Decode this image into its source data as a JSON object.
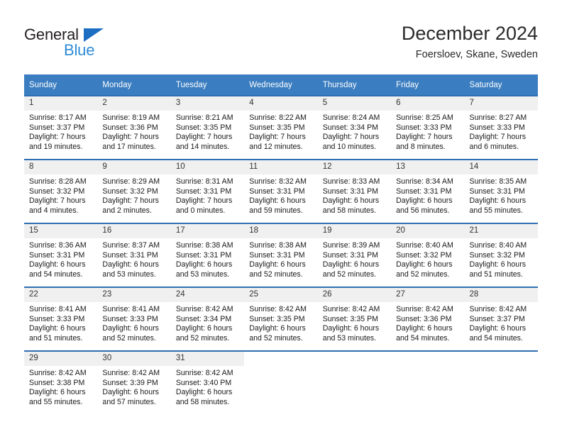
{
  "brand": {
    "name_top": "General",
    "name_bottom": "Blue",
    "triangle_color": "#1b6ec2",
    "top_color": "#231f20",
    "bottom_color": "#2e8bd8"
  },
  "header": {
    "title": "December 2024",
    "subtitle": "Foersloev, Skane, Sweden"
  },
  "theme": {
    "header_bg": "#3a7dc0",
    "header_text": "#ffffff",
    "row_divider": "#2f6fb0",
    "daynum_bg": "#f0f0f0",
    "page_bg": "#ffffff"
  },
  "calendar": {
    "weekday_headers": [
      "Sunday",
      "Monday",
      "Tuesday",
      "Wednesday",
      "Thursday",
      "Friday",
      "Saturday"
    ],
    "weeks": [
      [
        {
          "day": "1",
          "lines": [
            "Sunrise: 8:17 AM",
            "Sunset: 3:37 PM",
            "Daylight: 7 hours",
            "and 19 minutes."
          ]
        },
        {
          "day": "2",
          "lines": [
            "Sunrise: 8:19 AM",
            "Sunset: 3:36 PM",
            "Daylight: 7 hours",
            "and 17 minutes."
          ]
        },
        {
          "day": "3",
          "lines": [
            "Sunrise: 8:21 AM",
            "Sunset: 3:35 PM",
            "Daylight: 7 hours",
            "and 14 minutes."
          ]
        },
        {
          "day": "4",
          "lines": [
            "Sunrise: 8:22 AM",
            "Sunset: 3:35 PM",
            "Daylight: 7 hours",
            "and 12 minutes."
          ]
        },
        {
          "day": "5",
          "lines": [
            "Sunrise: 8:24 AM",
            "Sunset: 3:34 PM",
            "Daylight: 7 hours",
            "and 10 minutes."
          ]
        },
        {
          "day": "6",
          "lines": [
            "Sunrise: 8:25 AM",
            "Sunset: 3:33 PM",
            "Daylight: 7 hours",
            "and 8 minutes."
          ]
        },
        {
          "day": "7",
          "lines": [
            "Sunrise: 8:27 AM",
            "Sunset: 3:33 PM",
            "Daylight: 7 hours",
            "and 6 minutes."
          ]
        }
      ],
      [
        {
          "day": "8",
          "lines": [
            "Sunrise: 8:28 AM",
            "Sunset: 3:32 PM",
            "Daylight: 7 hours",
            "and 4 minutes."
          ]
        },
        {
          "day": "9",
          "lines": [
            "Sunrise: 8:29 AM",
            "Sunset: 3:32 PM",
            "Daylight: 7 hours",
            "and 2 minutes."
          ]
        },
        {
          "day": "10",
          "lines": [
            "Sunrise: 8:31 AM",
            "Sunset: 3:31 PM",
            "Daylight: 7 hours",
            "and 0 minutes."
          ]
        },
        {
          "day": "11",
          "lines": [
            "Sunrise: 8:32 AM",
            "Sunset: 3:31 PM",
            "Daylight: 6 hours",
            "and 59 minutes."
          ]
        },
        {
          "day": "12",
          "lines": [
            "Sunrise: 8:33 AM",
            "Sunset: 3:31 PM",
            "Daylight: 6 hours",
            "and 58 minutes."
          ]
        },
        {
          "day": "13",
          "lines": [
            "Sunrise: 8:34 AM",
            "Sunset: 3:31 PM",
            "Daylight: 6 hours",
            "and 56 minutes."
          ]
        },
        {
          "day": "14",
          "lines": [
            "Sunrise: 8:35 AM",
            "Sunset: 3:31 PM",
            "Daylight: 6 hours",
            "and 55 minutes."
          ]
        }
      ],
      [
        {
          "day": "15",
          "lines": [
            "Sunrise: 8:36 AM",
            "Sunset: 3:31 PM",
            "Daylight: 6 hours",
            "and 54 minutes."
          ]
        },
        {
          "day": "16",
          "lines": [
            "Sunrise: 8:37 AM",
            "Sunset: 3:31 PM",
            "Daylight: 6 hours",
            "and 53 minutes."
          ]
        },
        {
          "day": "17",
          "lines": [
            "Sunrise: 8:38 AM",
            "Sunset: 3:31 PM",
            "Daylight: 6 hours",
            "and 53 minutes."
          ]
        },
        {
          "day": "18",
          "lines": [
            "Sunrise: 8:38 AM",
            "Sunset: 3:31 PM",
            "Daylight: 6 hours",
            "and 52 minutes."
          ]
        },
        {
          "day": "19",
          "lines": [
            "Sunrise: 8:39 AM",
            "Sunset: 3:31 PM",
            "Daylight: 6 hours",
            "and 52 minutes."
          ]
        },
        {
          "day": "20",
          "lines": [
            "Sunrise: 8:40 AM",
            "Sunset: 3:32 PM",
            "Daylight: 6 hours",
            "and 52 minutes."
          ]
        },
        {
          "day": "21",
          "lines": [
            "Sunrise: 8:40 AM",
            "Sunset: 3:32 PM",
            "Daylight: 6 hours",
            "and 51 minutes."
          ]
        }
      ],
      [
        {
          "day": "22",
          "lines": [
            "Sunrise: 8:41 AM",
            "Sunset: 3:33 PM",
            "Daylight: 6 hours",
            "and 51 minutes."
          ]
        },
        {
          "day": "23",
          "lines": [
            "Sunrise: 8:41 AM",
            "Sunset: 3:33 PM",
            "Daylight: 6 hours",
            "and 52 minutes."
          ]
        },
        {
          "day": "24",
          "lines": [
            "Sunrise: 8:42 AM",
            "Sunset: 3:34 PM",
            "Daylight: 6 hours",
            "and 52 minutes."
          ]
        },
        {
          "day": "25",
          "lines": [
            "Sunrise: 8:42 AM",
            "Sunset: 3:35 PM",
            "Daylight: 6 hours",
            "and 52 minutes."
          ]
        },
        {
          "day": "26",
          "lines": [
            "Sunrise: 8:42 AM",
            "Sunset: 3:35 PM",
            "Daylight: 6 hours",
            "and 53 minutes."
          ]
        },
        {
          "day": "27",
          "lines": [
            "Sunrise: 8:42 AM",
            "Sunset: 3:36 PM",
            "Daylight: 6 hours",
            "and 54 minutes."
          ]
        },
        {
          "day": "28",
          "lines": [
            "Sunrise: 8:42 AM",
            "Sunset: 3:37 PM",
            "Daylight: 6 hours",
            "and 54 minutes."
          ]
        }
      ],
      [
        {
          "day": "29",
          "lines": [
            "Sunrise: 8:42 AM",
            "Sunset: 3:38 PM",
            "Daylight: 6 hours",
            "and 55 minutes."
          ]
        },
        {
          "day": "30",
          "lines": [
            "Sunrise: 8:42 AM",
            "Sunset: 3:39 PM",
            "Daylight: 6 hours",
            "and 57 minutes."
          ]
        },
        {
          "day": "31",
          "lines": [
            "Sunrise: 8:42 AM",
            "Sunset: 3:40 PM",
            "Daylight: 6 hours",
            "and 58 minutes."
          ]
        },
        {
          "day": "",
          "lines": []
        },
        {
          "day": "",
          "lines": []
        },
        {
          "day": "",
          "lines": []
        },
        {
          "day": "",
          "lines": []
        }
      ]
    ]
  }
}
